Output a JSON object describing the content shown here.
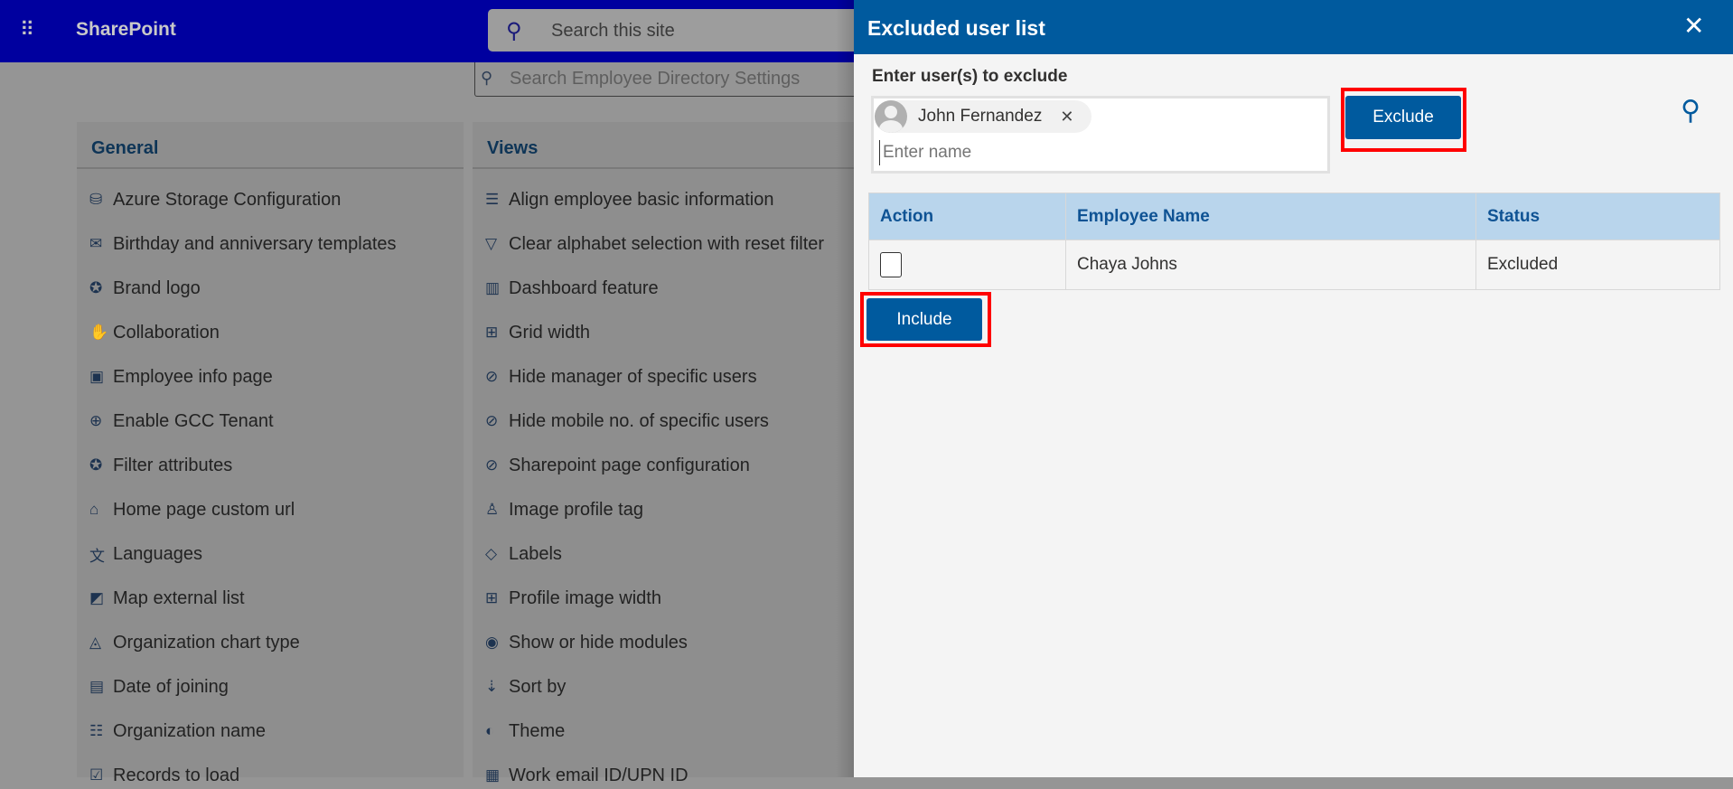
{
  "topbar": {
    "brand": "SharePoint",
    "site_search_placeholder": "Search this site",
    "waffle_icon": "waffle-icon",
    "search_icon": "search-icon"
  },
  "settings_search": {
    "placeholder": "Search Employee Directory Settings"
  },
  "general": {
    "title": "General",
    "items": [
      {
        "icon": "database-icon",
        "glyph": "⛁",
        "label": "Azure Storage Configuration"
      },
      {
        "icon": "template-icon",
        "glyph": "✉",
        "label": "Birthday and anniversary templates"
      },
      {
        "icon": "badge-icon",
        "glyph": "✪",
        "label": "Brand logo"
      },
      {
        "icon": "handshake-icon",
        "glyph": "✋",
        "label": "Collaboration"
      },
      {
        "icon": "person-page-icon",
        "glyph": "▣",
        "label": "Employee info page"
      },
      {
        "icon": "globe-icon",
        "glyph": "⊕",
        "label": "Enable GCC Tenant"
      },
      {
        "icon": "filter-badge-icon",
        "glyph": "✪",
        "label": "Filter attributes"
      },
      {
        "icon": "home-icon",
        "glyph": "⌂",
        "label": "Home page custom url"
      },
      {
        "icon": "translate-icon",
        "glyph": "文",
        "label": "Languages"
      },
      {
        "icon": "map-icon",
        "glyph": "◩",
        "label": "Map external list"
      },
      {
        "icon": "area-chart-icon",
        "glyph": "◬",
        "label": "Organization chart type"
      },
      {
        "icon": "calendar-clock-icon",
        "glyph": "▤",
        "label": "Date of joining"
      },
      {
        "icon": "org-chart-icon",
        "glyph": "☷",
        "label": "Organization name"
      },
      {
        "icon": "checkbox-icon",
        "glyph": "☑",
        "label": "Records to load"
      }
    ]
  },
  "views": {
    "title": "Views",
    "items": [
      {
        "icon": "align-icon",
        "glyph": "☰",
        "label": "Align employee basic information"
      },
      {
        "icon": "filter-icon",
        "glyph": "▽",
        "label": "Clear alphabet selection with reset filter"
      },
      {
        "icon": "bar-chart-icon",
        "glyph": "▥",
        "label": "Dashboard feature"
      },
      {
        "icon": "grid-icon",
        "glyph": "⊞",
        "label": "Grid width"
      },
      {
        "icon": "hide-icon",
        "glyph": "⊘",
        "label": "Hide manager of specific users"
      },
      {
        "icon": "hide-icon",
        "glyph": "⊘",
        "label": "Hide mobile no. of specific users"
      },
      {
        "icon": "hide-icon",
        "glyph": "⊘",
        "label": "Sharepoint page configuration"
      },
      {
        "icon": "person-tag-icon",
        "glyph": "♙",
        "label": "Image profile tag"
      },
      {
        "icon": "tag-icon",
        "glyph": "◇",
        "label": "Labels"
      },
      {
        "icon": "grid-icon",
        "glyph": "⊞",
        "label": "Profile image width"
      },
      {
        "icon": "eye-icon",
        "glyph": "◉",
        "label": "Show or hide modules"
      },
      {
        "icon": "sort-icon",
        "glyph": "⇣",
        "label": "Sort by"
      },
      {
        "icon": "palette-icon",
        "glyph": "◐",
        "label": "Theme"
      },
      {
        "icon": "mail-folder-icon",
        "glyph": "▦",
        "label": "Work email ID/UPN ID"
      }
    ]
  },
  "panel": {
    "title": "Excluded user list",
    "close_icon": "close-icon",
    "label": "Enter user(s) to exclude",
    "chip": {
      "name": "John Fernandez",
      "remove_icon": "close-icon"
    },
    "input_placeholder": "Enter name",
    "exclude_label": "Exclude",
    "include_label": "Include",
    "highlight_color": "#ff0000",
    "accent": "#005a9e",
    "table": {
      "headers": [
        "Action",
        "Employee Name",
        "Status"
      ],
      "rows": [
        {
          "checked": false,
          "name": "Chaya Johns",
          "status": "Excluded"
        }
      ]
    }
  }
}
